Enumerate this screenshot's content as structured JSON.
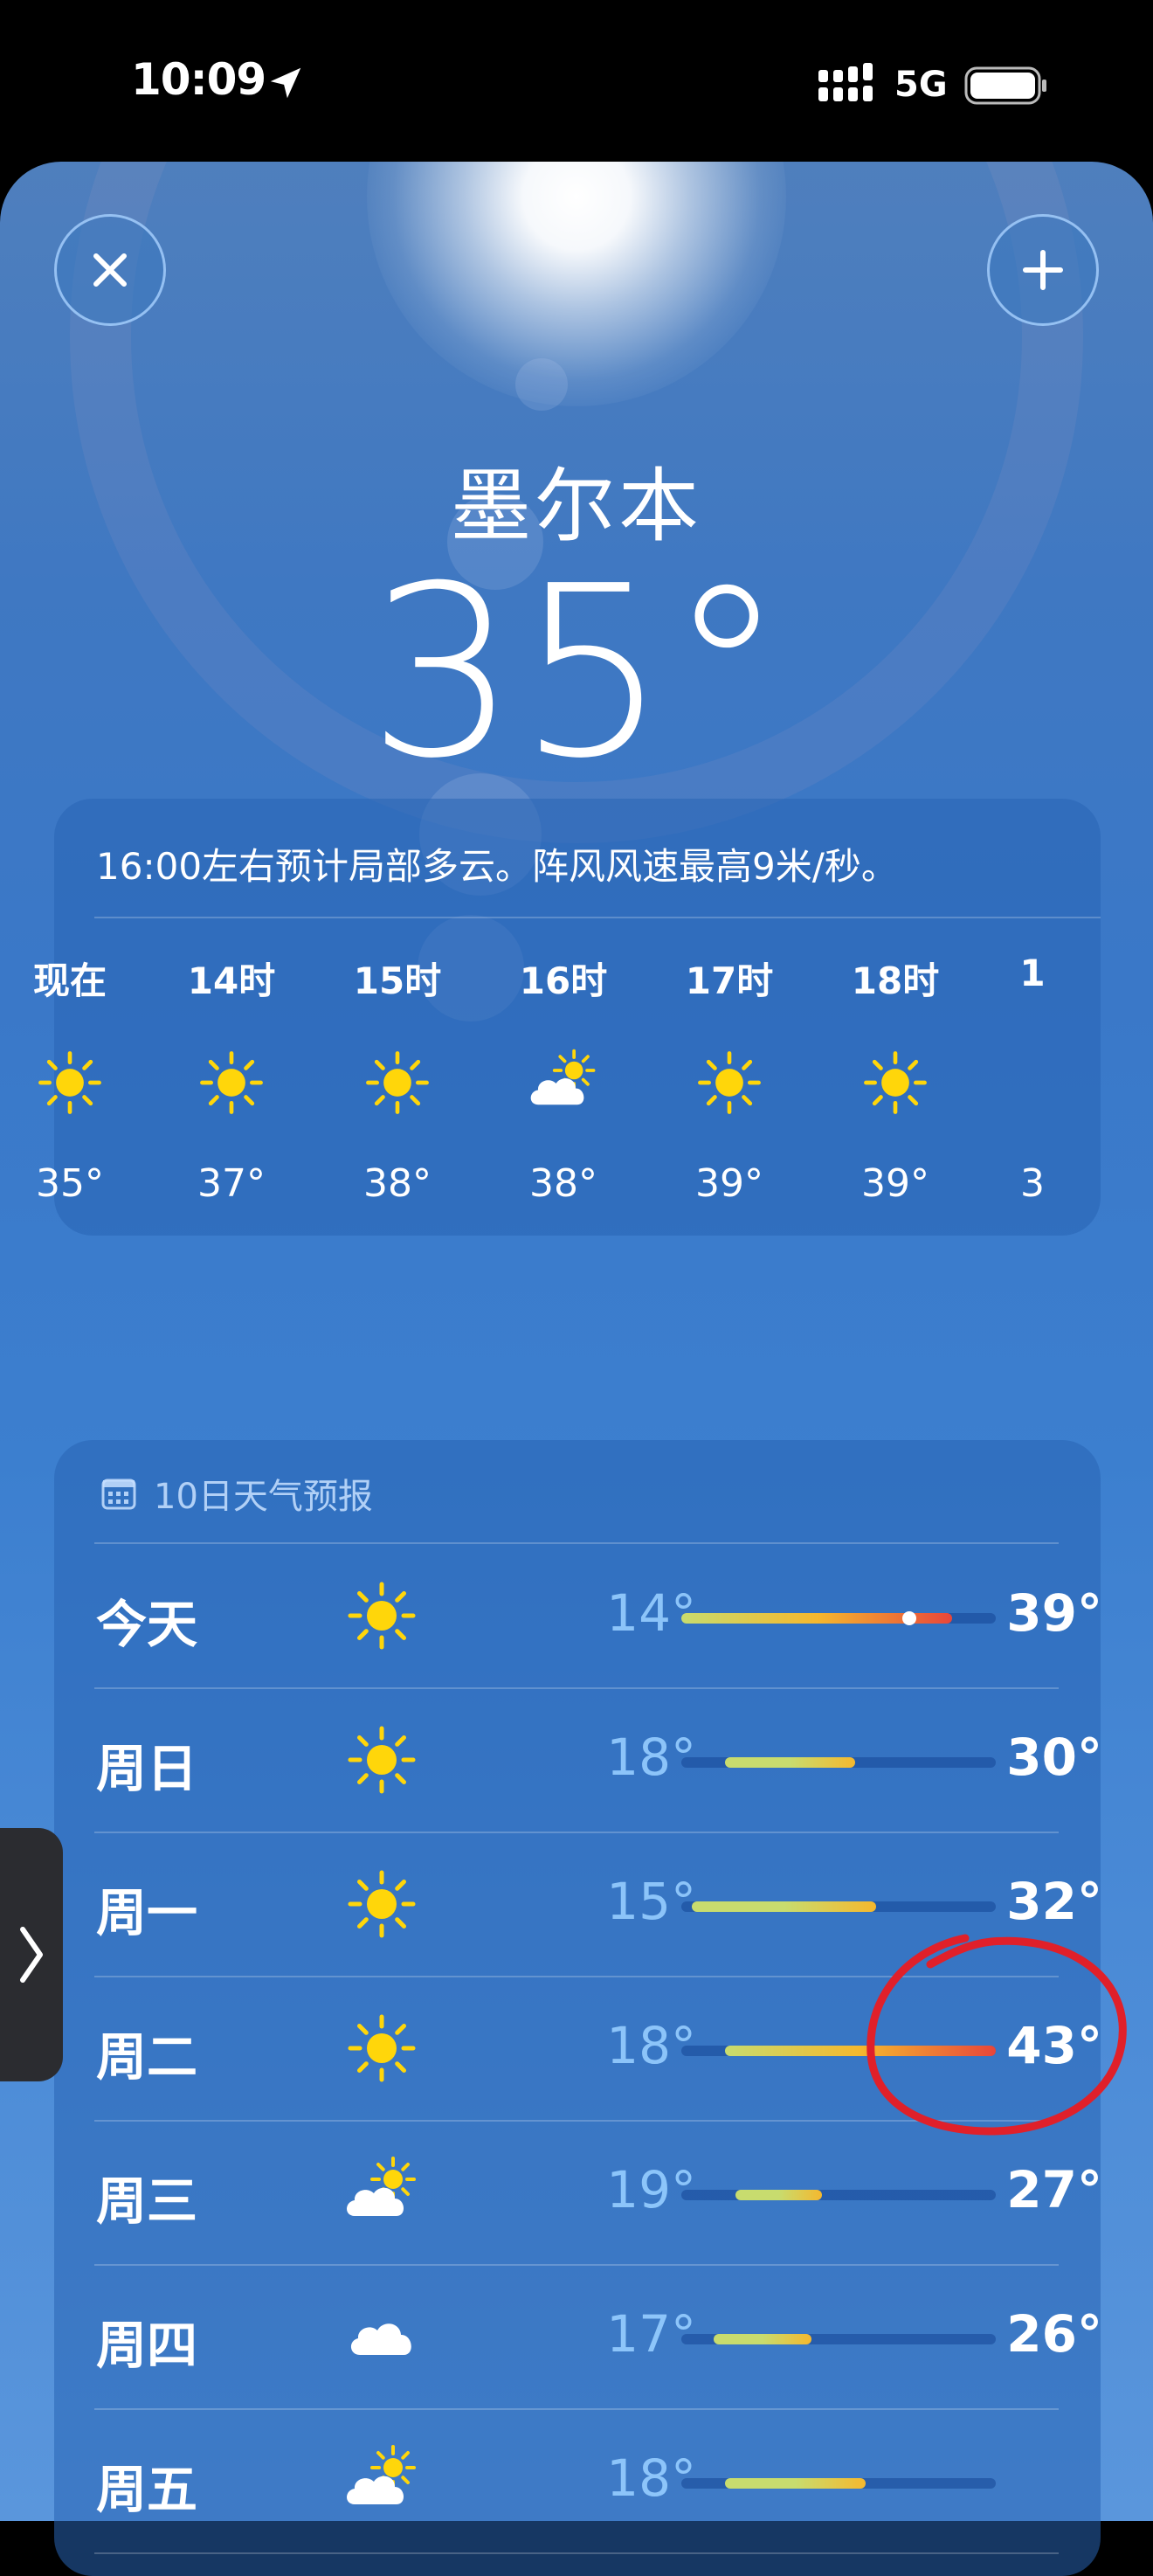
{
  "status_bar": {
    "time": "10:09",
    "network": "5G",
    "icons": [
      "location-arrow-icon",
      "signal-icon",
      "battery-icon"
    ]
  },
  "header": {
    "close_icon": "close-icon",
    "add_icon": "plus-icon"
  },
  "location": {
    "city": "墨尔本",
    "current_temp": "35°"
  },
  "hourly": {
    "summary": "16:00左右预计局部多云。阵风风速最高9米/秒。",
    "items": [
      {
        "label": "现在",
        "icon": "sun-icon",
        "temp": "35°"
      },
      {
        "label": "14时",
        "icon": "sun-icon",
        "temp": "37°"
      },
      {
        "label": "15时",
        "icon": "sun-icon",
        "temp": "38°"
      },
      {
        "label": "16时",
        "icon": "partly-cloudy-icon",
        "temp": "38°"
      },
      {
        "label": "17时",
        "icon": "sun-icon",
        "temp": "39°"
      },
      {
        "label": "18时",
        "icon": "sun-icon",
        "temp": "39°"
      },
      {
        "label": "1",
        "icon": "",
        "temp": "3"
      }
    ]
  },
  "daily": {
    "header": "10日天气预报",
    "header_icon": "calendar-icon",
    "range_min": 14,
    "range_max": 43,
    "days": [
      {
        "name": "今天",
        "icon": "sun-icon",
        "low": "14°",
        "high": "39°",
        "low_val": 14,
        "high_val": 39,
        "current_val": 35
      },
      {
        "name": "周日",
        "icon": "sun-icon",
        "low": "18°",
        "high": "30°",
        "low_val": 18,
        "high_val": 30
      },
      {
        "name": "周一",
        "icon": "sun-icon",
        "low": "15°",
        "high": "32°",
        "low_val": 15,
        "high_val": 32
      },
      {
        "name": "周二",
        "icon": "sun-icon",
        "low": "18°",
        "high": "43°",
        "low_val": 18,
        "high_val": 43
      },
      {
        "name": "周三",
        "icon": "partly-cloudy-icon",
        "low": "19°",
        "high": "27°",
        "low_val": 19,
        "high_val": 27
      },
      {
        "name": "周四",
        "icon": "cloud-icon",
        "low": "17°",
        "high": "26°",
        "low_val": 17,
        "high_val": 26
      },
      {
        "name": "周五",
        "icon": "partly-cloudy-icon",
        "low": "18°",
        "high": "",
        "low_val": 18,
        "high_val": 31
      }
    ]
  },
  "colors": {
    "sun": "#FFD60A",
    "bar_cool": "#C8DC6E",
    "bar_warm": "#F5B82E",
    "bar_hot": "#E8463A",
    "annotation": "#E0202A"
  }
}
